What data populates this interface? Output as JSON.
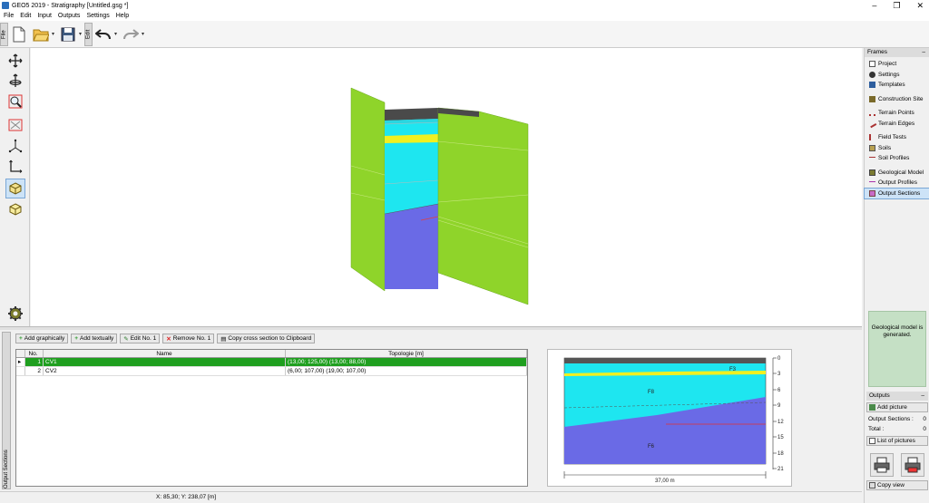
{
  "window": {
    "title": "GEO5 2019 - Stratigraphy [Untitled.gsg *]",
    "min": "–",
    "max": "❐",
    "close": "✕"
  },
  "menu": [
    "File",
    "Edit",
    "Input",
    "Outputs",
    "Settings",
    "Help"
  ],
  "toolbar": {
    "file_tab": "File",
    "edit_tab": "Edit"
  },
  "frames": {
    "header": "Frames",
    "min": "–",
    "groups": [
      [
        {
          "label": "Project",
          "icon": "document-icon"
        },
        {
          "label": "Settings",
          "icon": "gear-icon"
        },
        {
          "label": "Templates",
          "icon": "templates-icon"
        }
      ],
      [
        {
          "label": "Construction Site",
          "icon": "construction-site-icon"
        }
      ],
      [
        {
          "label": "Terrain Points",
          "icon": "terrain-points-icon"
        },
        {
          "label": "Terrain Edges",
          "icon": "terrain-edges-icon"
        }
      ],
      [
        {
          "label": "Field Tests",
          "icon": "field-tests-icon"
        },
        {
          "label": "Soils",
          "icon": "soils-icon"
        },
        {
          "label": "Soil Profiles",
          "icon": "soil-profiles-icon"
        }
      ],
      [
        {
          "label": "Geological Model",
          "icon": "geological-model-icon"
        },
        {
          "label": "Output Profiles",
          "icon": "output-profiles-icon"
        },
        {
          "label": "Output Sections",
          "icon": "output-sections-icon",
          "selected": true
        }
      ]
    ]
  },
  "generated_msg": "Geological model is generated.",
  "outputs": {
    "header": "Outputs",
    "min": "–",
    "add_picture": "Add picture",
    "output_sections_label": "Output Sections :",
    "output_sections_count": "0",
    "total_label": "Total :",
    "total_count": "0",
    "list_pictures": "List of pictures",
    "copy_view": "Copy view"
  },
  "bottom": {
    "vtab": "Output Sections",
    "buttons": {
      "add_graphically": "Add graphically",
      "add_textually": "Add textually",
      "edit": "Edit No. 1",
      "remove": "Remove No. 1",
      "copy": "Copy cross section to Clipboard"
    },
    "table": {
      "headers": {
        "no": "No.",
        "name": "Name",
        "topology": "Topologie [m]"
      },
      "rows": [
        {
          "pointer": "▸",
          "no": "1",
          "name": "CV1",
          "topology": "(13,00; 125,00) (13,00; 88,00)",
          "selected": true
        },
        {
          "pointer": "",
          "no": "2",
          "name": "CV2",
          "topology": "(6,00; 107,00) (19,00; 107,00)",
          "selected": false
        }
      ]
    }
  },
  "section_preview": {
    "layer_labels": [
      "F3",
      "F8",
      "F6"
    ],
    "depth_ticks": [
      "0",
      "3",
      "6",
      "9",
      "12",
      "15",
      "18",
      "21"
    ],
    "width_label": "37,00 m"
  },
  "status": {
    "coords": "X: 85,30; Y: 238,07 [m]"
  },
  "colors": {
    "accent_green": "#1f9f1f",
    "model_green": "#8fd42a",
    "layer_cyan": "#1ee6f0",
    "layer_blue": "#6a6ae6",
    "layer_yellow": "#f0f020"
  }
}
